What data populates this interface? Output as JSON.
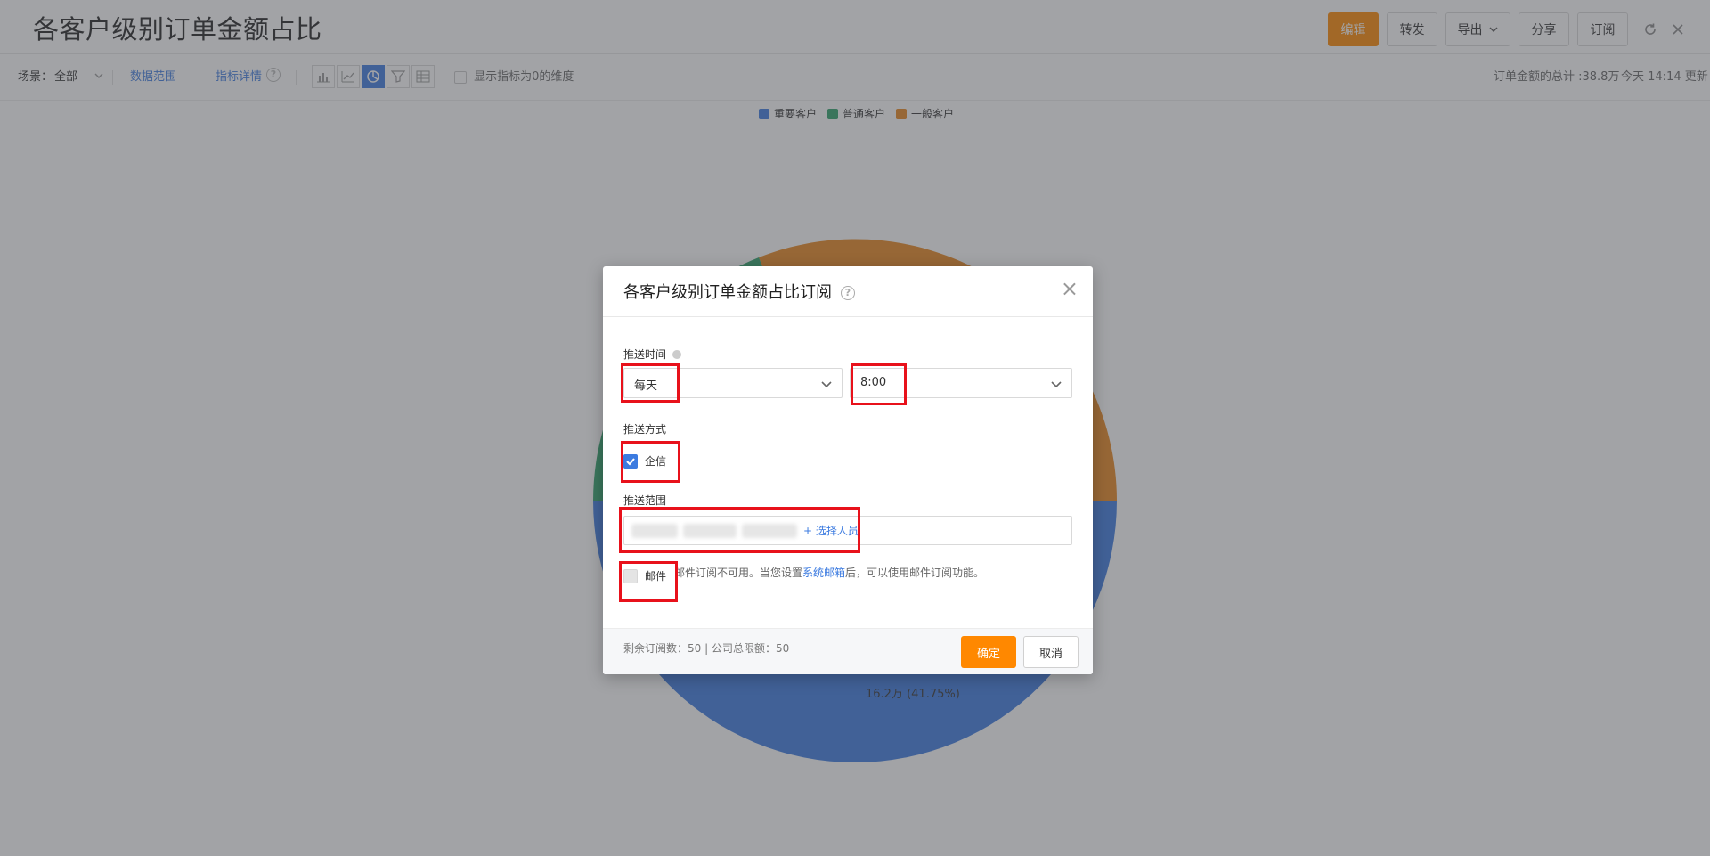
{
  "header": {
    "title": "各客户级别订单金额占比",
    "buttons": {
      "edit": "编辑",
      "forward": "转发",
      "export": "导出",
      "share": "分享",
      "subscribe": "订阅"
    },
    "icons": [
      "refresh-icon",
      "close-icon"
    ]
  },
  "toolbar": {
    "scene_label": "场景：",
    "scene_value": "全部",
    "data_range": "数据范围",
    "metric_detail": "指标详情",
    "chart_types": [
      "bar-chart-icon",
      "line-chart-icon",
      "pie-chart-icon",
      "funnel-chart-icon",
      "table-icon"
    ],
    "active_chart_type": "pie-chart-icon",
    "show_zero_label": "显示指标为0的维度",
    "total_text": "订单金额的总计 :38.8万",
    "update_text": "今天 14:14 更新"
  },
  "chart_data": {
    "type": "pie",
    "legend": [
      "重要客户",
      "普通客户",
      "一般客户"
    ],
    "colors": [
      "#3c7be0",
      "#2fa36a",
      "#e8871e"
    ],
    "visible_label": "16.2万 (41.75%)"
  },
  "modal": {
    "title": "各客户级别订单金额占比订阅",
    "push_time": {
      "label": "推送时间",
      "frequency": "每天",
      "time": "8:00"
    },
    "push_method": {
      "label": "推送方式",
      "qixin": "企信",
      "qixin_checked": true,
      "mail": "邮件",
      "mail_checked": false,
      "mail_note_prefix": "邮件订阅不可用。当您设置",
      "mail_note_link": "系统邮箱",
      "mail_note_suffix": "后，可以使用邮件订阅功能。"
    },
    "push_scope": {
      "label": "推送范围",
      "add_person": "+ 选择人员"
    },
    "footer": {
      "quota": "剩余订阅数：50 | 公司总限额：50",
      "ok": "确定",
      "cancel": "取消"
    }
  }
}
